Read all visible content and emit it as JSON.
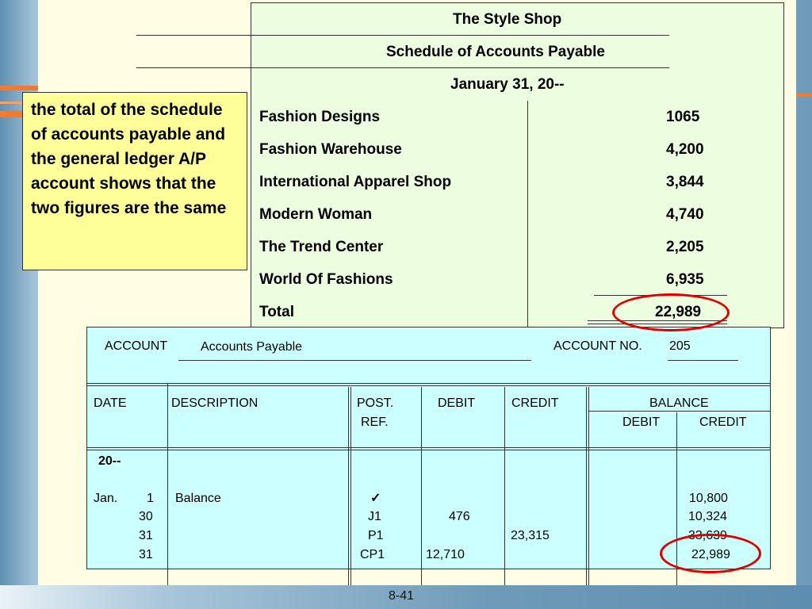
{
  "schedule": {
    "company": "The Style Shop",
    "title": "Schedule of Accounts Payable",
    "date": "January 31, 20--",
    "rows": [
      {
        "name": "Fashion Designs",
        "amount": "1065"
      },
      {
        "name": "Fashion Warehouse",
        "amount": "4,200"
      },
      {
        "name": "International Apparel Shop",
        "amount": "3,844"
      },
      {
        "name": "Modern Woman",
        "amount": "4,740"
      },
      {
        "name": "The Trend Center",
        "amount": "2,205"
      },
      {
        "name": "World Of Fashions",
        "amount": "6,935"
      }
    ],
    "total_label": "Total",
    "total_amount": "22,989"
  },
  "note": {
    "text": "the total of the schedule of accounts payable and the general ledger A/P account shows that the two figures are the same"
  },
  "ledger": {
    "account_label": "ACCOUNT",
    "account_name": "Accounts Payable",
    "account_no_label": "ACCOUNT NO.",
    "account_no": "205",
    "headers": {
      "date": "DATE",
      "description": "DESCRIPTION",
      "post": "POST.",
      "ref": "REF.",
      "debit": "DEBIT",
      "credit": "CREDIT",
      "balance": "BALANCE",
      "bal_debit": "DEBIT",
      "bal_credit": "CREDIT"
    },
    "year": "20--",
    "rows": [
      {
        "month": "Jan.",
        "day": "1",
        "description": "Balance",
        "ref": "✓",
        "debit": "",
        "credit": "",
        "bal_credit": "10,800"
      },
      {
        "month": "",
        "day": "30",
        "description": "",
        "ref": "J1",
        "debit": "476",
        "credit": "",
        "bal_credit": "10,324"
      },
      {
        "month": "",
        "day": "31",
        "description": "",
        "ref": "P1",
        "debit": "",
        "credit": "23,315",
        "bal_credit": "33,639"
      },
      {
        "month": "",
        "day": "31",
        "description": "",
        "ref": "CP1",
        "debit": "12,710",
        "credit": "",
        "bal_credit": "22,989"
      }
    ]
  },
  "footer": {
    "page": "8-41"
  },
  "colors": {
    "highlight": "#e00000",
    "note_bg": "#ffff99",
    "schedule_bg": "#edfde0",
    "ledger_bg": "#ccffff"
  }
}
